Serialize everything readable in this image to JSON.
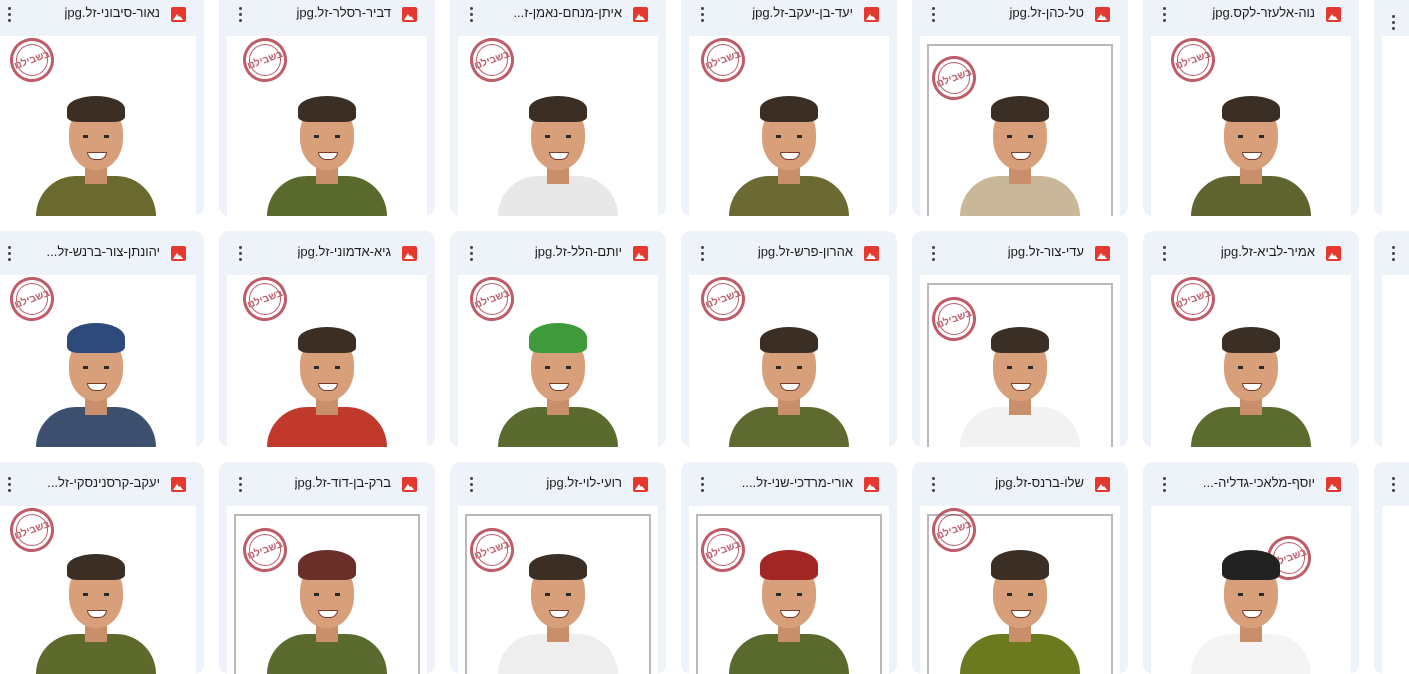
{
  "files": [
    {
      "name": "נוה-אלעזר-לקס.jpg",
      "icon": "image-file-icon"
    },
    {
      "name": "טל-כהן-זל.jpg",
      "icon": "image-file-icon"
    },
    {
      "name": "יעד-בן-יעקב-זל.jpg",
      "icon": "image-file-icon"
    },
    {
      "name": "איתן-מנחם-נאמן-ז...",
      "icon": "image-file-icon"
    },
    {
      "name": "דביר-רסלר-זל.jpg",
      "icon": "image-file-icon"
    },
    {
      "name": "נאור-סיבוני-זל.jpg",
      "icon": "image-file-icon"
    },
    {
      "name": "אמיר-לביא-זל.jpg",
      "icon": "image-file-icon"
    },
    {
      "name": "עדי-צור-זל.jpg",
      "icon": "image-file-icon"
    },
    {
      "name": "אהרון-פרש-זל.jpg",
      "icon": "image-file-icon"
    },
    {
      "name": "יותם-הלל-זל.jpg",
      "icon": "image-file-icon"
    },
    {
      "name": "גיא-אדמוני-זל.jpg",
      "icon": "image-file-icon"
    },
    {
      "name": "יהונתן-צור-ברנש-זל...",
      "icon": "image-file-icon"
    },
    {
      "name": "יוסף-מלאכי-גדליה-...",
      "icon": "image-file-icon"
    },
    {
      "name": "שלו-ברנס-זל.jpg",
      "icon": "image-file-icon"
    },
    {
      "name": "אורי-מרדכי-שני-זל....",
      "icon": "image-file-icon"
    },
    {
      "name": "רועי-לוי-זל.jpg",
      "icon": "image-file-icon"
    },
    {
      "name": "ברק-בן-דוד-זל.jpg",
      "icon": "image-file-icon"
    },
    {
      "name": "יעקב-קרסנינסקי-זל...",
      "icon": "image-file-icon"
    }
  ],
  "stamp_text": "בשבילנו",
  "colors": {
    "card_bg": "#eef2f9",
    "icon_red": "#e5392f",
    "stamp": "#b5404f"
  }
}
